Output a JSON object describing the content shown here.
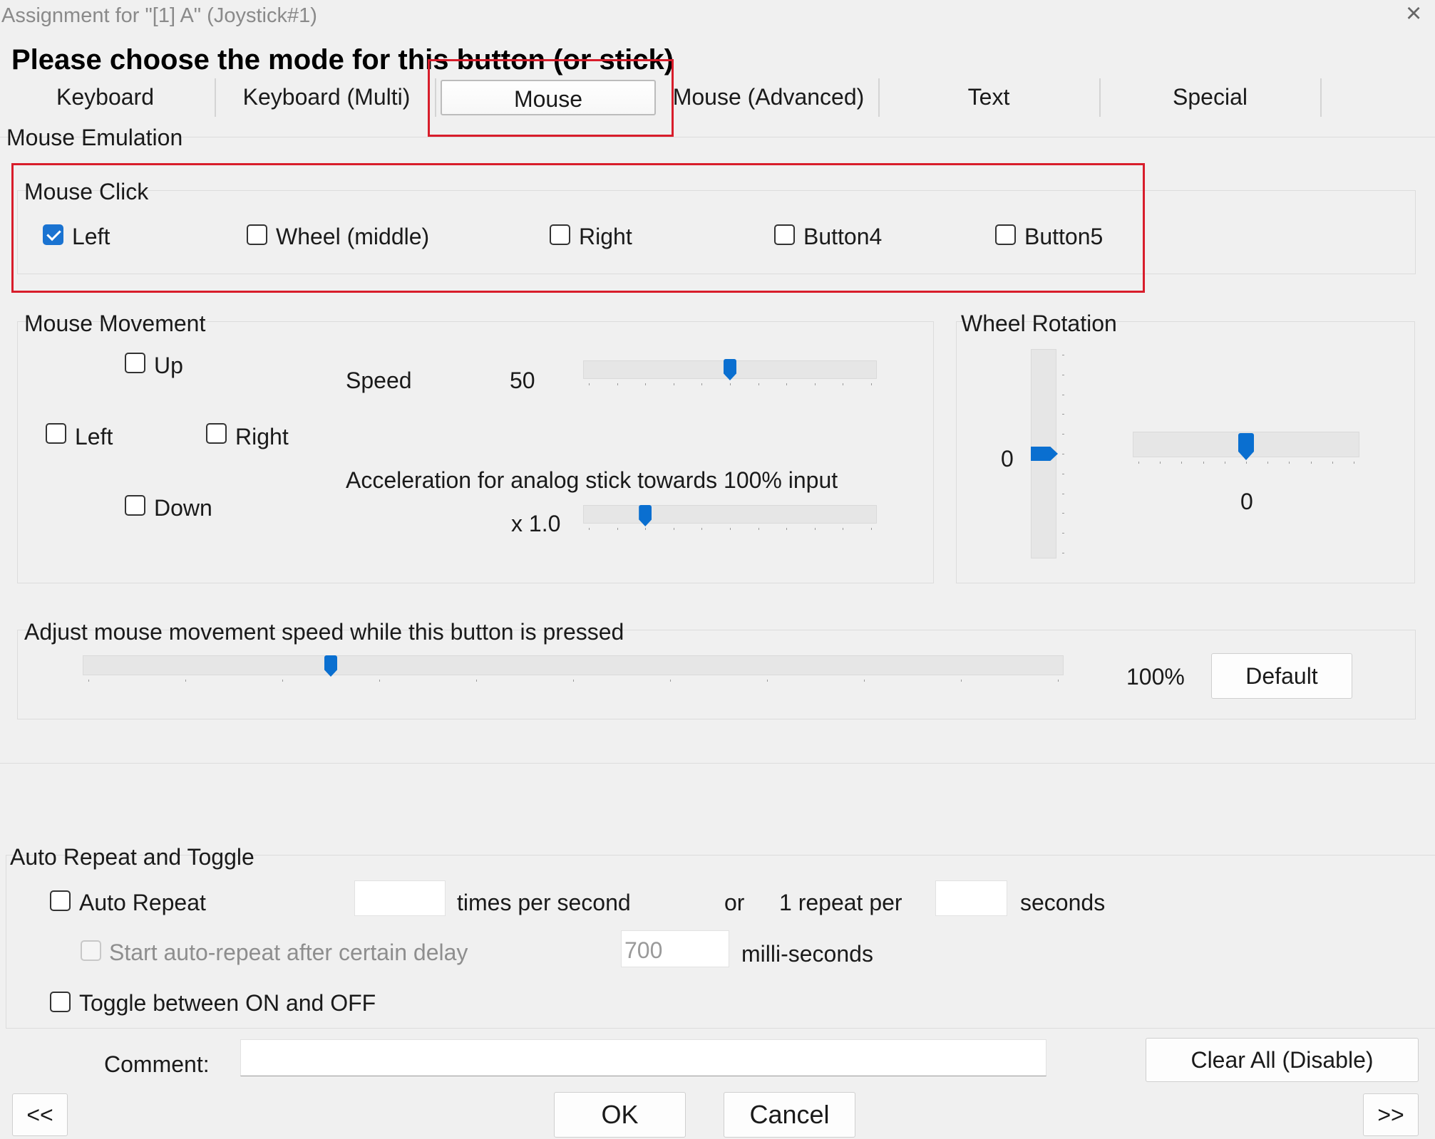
{
  "window": {
    "title": "Assignment for \"[1] A\" (Joystick#1)",
    "close_glyph": "×",
    "heading": "Please choose the mode for this button (or stick)"
  },
  "tabs": [
    {
      "label": "Keyboard",
      "selected": false
    },
    {
      "label": "Keyboard (Multi)",
      "selected": false
    },
    {
      "label": "Mouse",
      "selected": true
    },
    {
      "label": "Mouse (Advanced)",
      "selected": false
    },
    {
      "label": "Text",
      "selected": false
    },
    {
      "label": "Special",
      "selected": false
    }
  ],
  "mouse_emulation": {
    "label": "Mouse Emulation",
    "click": {
      "label": "Mouse Click",
      "options": [
        {
          "label": "Left",
          "checked": true
        },
        {
          "label": "Wheel (middle)",
          "checked": false
        },
        {
          "label": "Right",
          "checked": false
        },
        {
          "label": "Button4",
          "checked": false
        },
        {
          "label": "Button5",
          "checked": false
        }
      ]
    },
    "movement": {
      "label": "Mouse Movement",
      "up": "Up",
      "left": "Left",
      "right": "Right",
      "down": "Down",
      "speed_label": "Speed",
      "speed_value": "50",
      "speed_level": 0.5,
      "accel_label": "Acceleration for analog stick towards 100% input",
      "accel_value": "x 1.0",
      "accel_level": 0.2
    },
    "wheel": {
      "label": "Wheel Rotation",
      "vertical_value": "0",
      "vertical_level": 0.5,
      "horizontal_value": "0",
      "horizontal_level": 0.5
    },
    "adjust": {
      "label": "Adjust mouse movement speed while this button is pressed",
      "value": "100%",
      "level": 0.25,
      "default_button": "Default"
    }
  },
  "auto_repeat": {
    "label": "Auto Repeat and Toggle",
    "auto_repeat_label": "Auto Repeat",
    "times_label": "times per second",
    "or_label": "or",
    "repeat_per_label": "1 repeat per",
    "seconds_label": "seconds",
    "times_value": "",
    "seconds_value": "",
    "delay_label": "Start auto-repeat after certain delay",
    "delay_value": "700",
    "ms_label": "milli-seconds",
    "toggle_label": "Toggle between ON and OFF"
  },
  "footer": {
    "comment_label": "Comment:",
    "comment_value": "",
    "clear_all": "Clear All (Disable)",
    "prev": "<<",
    "ok": "OK",
    "cancel": "Cancel",
    "next": ">>"
  },
  "colors": {
    "accent": "#0a6fd0",
    "highlight": "#d81d2b",
    "background": "#f0f0f0"
  }
}
